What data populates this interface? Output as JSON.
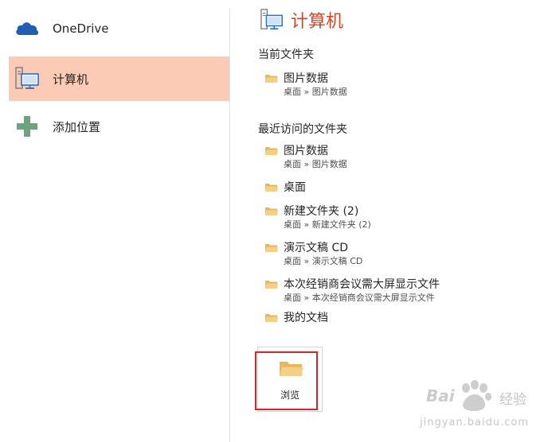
{
  "nav": {
    "items": [
      {
        "label": "OneDrive",
        "icon": "cloud-icon",
        "selected": false
      },
      {
        "label": "计算机",
        "icon": "computer-icon",
        "selected": true
      },
      {
        "label": "添加位置",
        "icon": "plus-icon",
        "selected": false
      }
    ]
  },
  "pane": {
    "title": "计算机",
    "current_heading": "当前文件夹",
    "current_folders": [
      {
        "name": "图片数据",
        "path": "桌面 » 图片数据"
      }
    ],
    "recent_heading": "最近访问的文件夹",
    "recent_folders": [
      {
        "name": "图片数据",
        "path": "桌面 » 图片数据"
      },
      {
        "name": "桌面",
        "path": ""
      },
      {
        "name": "新建文件夹 (2)",
        "path": "桌面 » 新建文件夹 (2)"
      },
      {
        "name": "演示文稿 CD",
        "path": "桌面 » 演示文稿 CD"
      },
      {
        "name": "本次经销商会议需大屏显示文件",
        "path": "桌面 » 本次经销商会议需大屏显示文件"
      },
      {
        "name": "我的文档",
        "path": ""
      }
    ],
    "browse_label": "浏览"
  },
  "watermark": {
    "brand": "Bai",
    "product": "经验",
    "url": "jingyan.baidu.com"
  },
  "colors": {
    "accent": "#d24726",
    "selected_bg": "#fbcbb5",
    "folder": "#f2c46f",
    "highlight": "#d3252a"
  }
}
